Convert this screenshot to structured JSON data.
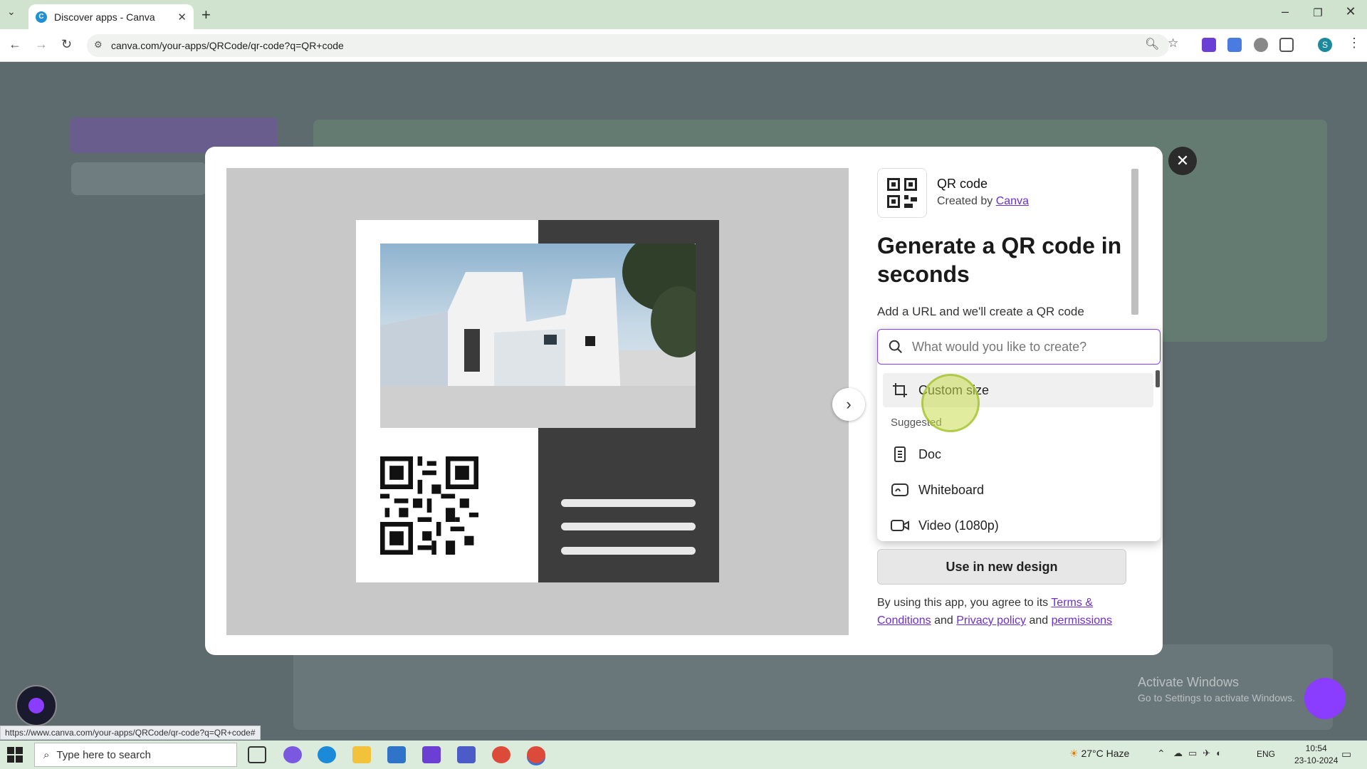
{
  "browser": {
    "tab_title": "Discover apps - Canva",
    "url": "canva.com/your-apps/QRCode/qr-code?q=QR+code",
    "status_url": "https://www.canva.com/your-apps/QRCode/qr-code?q=QR+code#"
  },
  "app": {
    "name": "QR code",
    "created_by_prefix": "Created by",
    "created_by_link": "Canva",
    "headline": "Generate a QR code in seconds",
    "description": "Add a URL and we'll create a QR code",
    "use_button": "Use in new design",
    "terms_prefix": "By using this app, you agree to its",
    "terms_link": "Terms & Conditions",
    "and1": "and",
    "privacy_link": "Privacy policy",
    "and2": "and",
    "permissions_link": "permissions"
  },
  "dropdown": {
    "placeholder": "What would you like to create?",
    "custom_size": "Custom size",
    "suggested_label": "Suggested",
    "items": [
      {
        "label": "Doc",
        "icon": "doc-icon"
      },
      {
        "label": "Whiteboard",
        "icon": "whiteboard-icon"
      },
      {
        "label": "Video (1080p)",
        "icon": "video-icon"
      }
    ]
  },
  "watermark": {
    "line1": "Activate Windows",
    "line2": "Go to Settings to activate Windows."
  },
  "taskbar": {
    "search_placeholder": "Type here to search",
    "weather": "27°C  Haze",
    "lang": "ENG",
    "time": "10:54",
    "date": "23-10-2024"
  },
  "colors": {
    "accent": "#8b3dff",
    "link": "#6d2ed0"
  }
}
